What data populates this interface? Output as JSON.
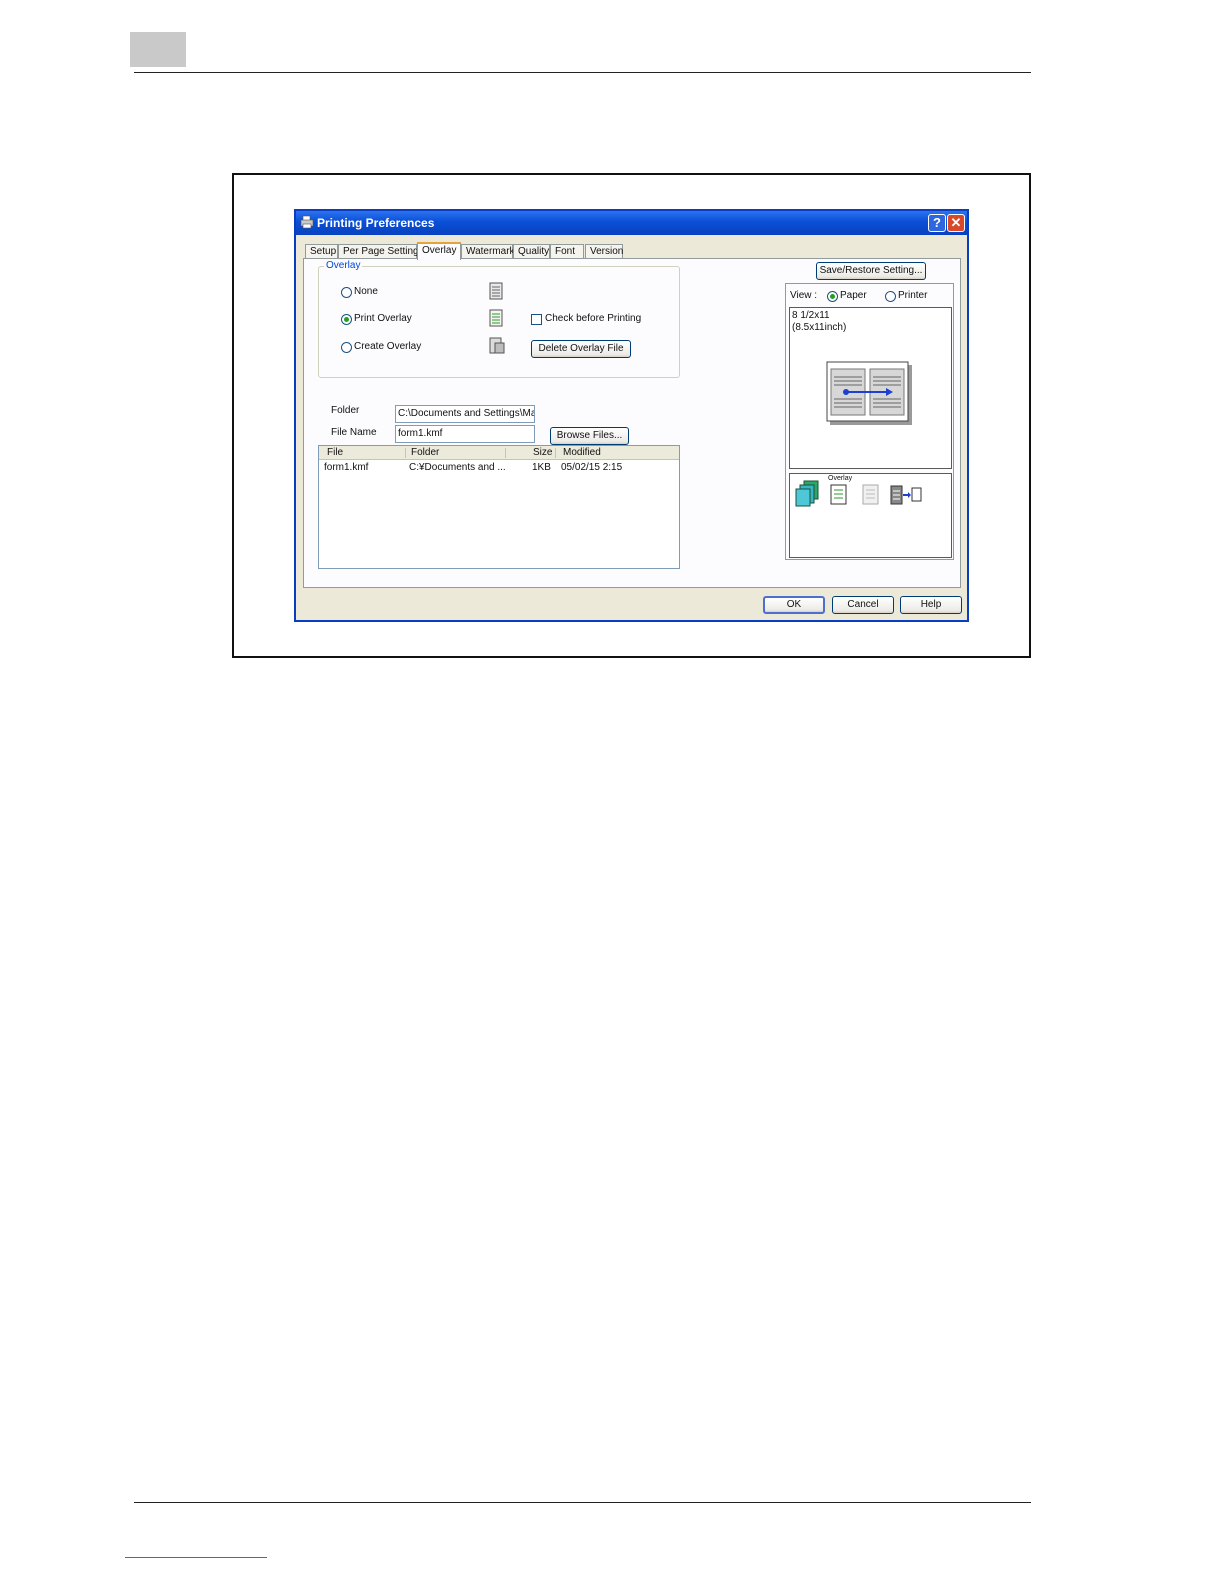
{
  "window": {
    "title": "Printing Preferences",
    "help_glyph": "?",
    "close_glyph": "✕",
    "tabs": [
      {
        "label": "Setup"
      },
      {
        "label": "Per Page Setting"
      },
      {
        "label": "Overlay"
      },
      {
        "label": "Watermark"
      },
      {
        "label": "Quality"
      },
      {
        "label": "Font"
      },
      {
        "label": "Version"
      }
    ],
    "active_tab": "Overlay"
  },
  "overlay_group": {
    "legend": "Overlay",
    "none_label": "None",
    "print_label": "Print Overlay",
    "create_label": "Create Overlay",
    "selected": "Print Overlay",
    "check_before_label": "Check before Printing",
    "check_before_checked": false,
    "delete_button": "Delete Overlay File"
  },
  "folder": {
    "label": "Folder",
    "value": "C:\\Documents and Settings\\Matsu"
  },
  "file_name": {
    "label": "File Name",
    "value": "form1.kmf"
  },
  "browse_button": "Browse Files...",
  "file_list": {
    "columns": [
      "File",
      "Folder",
      "Size",
      "Modified"
    ],
    "rows": [
      {
        "file": "form1.kmf",
        "folder": "C:¥Documents and ...",
        "size": "1KB",
        "modified": "05/02/15 2:15"
      }
    ]
  },
  "save_restore_button": "Save/Restore Setting...",
  "view": {
    "label": "View :",
    "paper_label": "Paper",
    "printer_label": "Printer",
    "selected": "Paper"
  },
  "paper_size": {
    "line1": "8 1/2x11",
    "line2": "(8.5x11inch)"
  },
  "overlay_badge": "Overlay",
  "footer": {
    "ok": "OK",
    "cancel": "Cancel",
    "help": "Help"
  },
  "colors": {
    "titlebar": "#0a4fd6",
    "dialog_face": "#ece9d8",
    "accent_tab": "#e6a33a",
    "group_legend": "#0046d5",
    "radio_dot": "#21a121"
  }
}
